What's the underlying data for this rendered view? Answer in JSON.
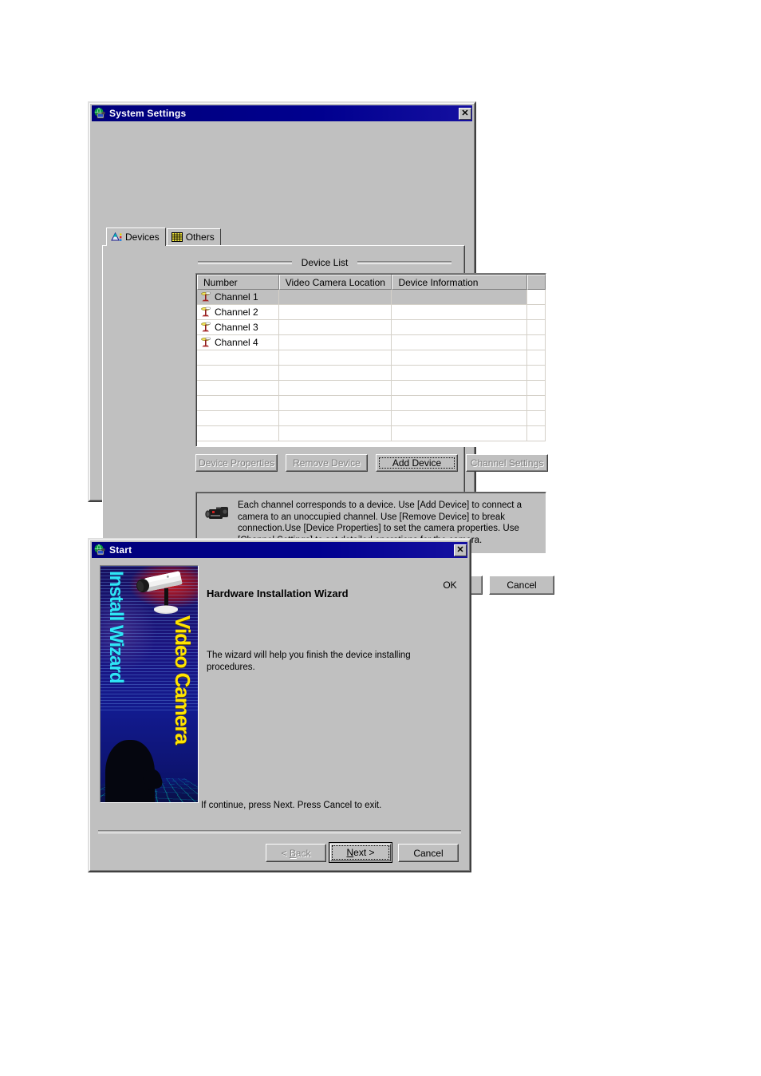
{
  "system_settings": {
    "title": "System Settings",
    "title_icon": "globe-camera-icon",
    "close_label": "✕",
    "tabs": [
      {
        "label": "Devices",
        "icon": "color-chart-icon",
        "active": true
      },
      {
        "label": "Others",
        "icon": "grid-icon",
        "active": false
      }
    ],
    "group_label": "Device List",
    "columns": [
      "Number",
      "Video Camera Location",
      "Device Information",
      ""
    ],
    "rows": [
      {
        "number": "Channel 1",
        "location": "",
        "info": "",
        "selected": true,
        "icon": "camera-stand-icon"
      },
      {
        "number": "Channel 2",
        "location": "",
        "info": "",
        "selected": false,
        "icon": "camera-stand-icon"
      },
      {
        "number": "Channel 3",
        "location": "",
        "info": "",
        "selected": false,
        "icon": "camera-stand-icon"
      },
      {
        "number": "Channel 4",
        "location": "",
        "info": "",
        "selected": false,
        "icon": "camera-stand-icon"
      },
      {
        "number": "",
        "location": "",
        "info": "",
        "selected": false,
        "icon": ""
      },
      {
        "number": "",
        "location": "",
        "info": "",
        "selected": false,
        "icon": ""
      },
      {
        "number": "",
        "location": "",
        "info": "",
        "selected": false,
        "icon": ""
      },
      {
        "number": "",
        "location": "",
        "info": "",
        "selected": false,
        "icon": ""
      },
      {
        "number": "",
        "location": "",
        "info": "",
        "selected": false,
        "icon": ""
      },
      {
        "number": "",
        "location": "",
        "info": "",
        "selected": false,
        "icon": ""
      }
    ],
    "action_buttons": [
      {
        "label": "Device Properties",
        "disabled": true,
        "focused": false
      },
      {
        "label": "Remove Device",
        "disabled": true,
        "focused": false
      },
      {
        "label": "Add Device",
        "disabled": false,
        "focused": true
      },
      {
        "label": "Channel Settings",
        "disabled": true,
        "focused": false
      }
    ],
    "info_icon": "camcorder-icon",
    "info_text": "Each channel corresponds to a device. Use [Add Device] to connect a camera to an unoccupied channel. Use [Remove Device] to break connection.Use [Device Properties] to set the camera properties. Use [Channel Settings] to set detailed operations for the camera.",
    "footer_buttons": [
      {
        "label": "OK",
        "disabled": false
      },
      {
        "label": "Cancel",
        "disabled": false
      }
    ]
  },
  "start_wizard": {
    "title": "Start",
    "title_icon": "globe-camera-icon",
    "close_label": "✕",
    "banner": {
      "left_text": "Install Wizard",
      "right_text": "Video Camera",
      "left_color": "#2fe6f7",
      "right_color": "#ffe400",
      "art": "security-camera-photo"
    },
    "heading": "Hardware Installation Wizard",
    "body_text": "The wizard will help you finish the device installing procedures.",
    "prompt_text": "If continue, press Next. Press Cancel to exit.",
    "buttons": [
      {
        "label": "< Back",
        "disabled": true,
        "default": false
      },
      {
        "label": "Next >",
        "disabled": false,
        "default": true
      },
      {
        "label": "Cancel",
        "disabled": false,
        "default": false
      }
    ]
  },
  "colors": {
    "face": "#c0c0c0",
    "titlebar": "#00007b",
    "shadow": "#808080",
    "highlight": "#ffffff",
    "selection": "#c0c0c0"
  }
}
